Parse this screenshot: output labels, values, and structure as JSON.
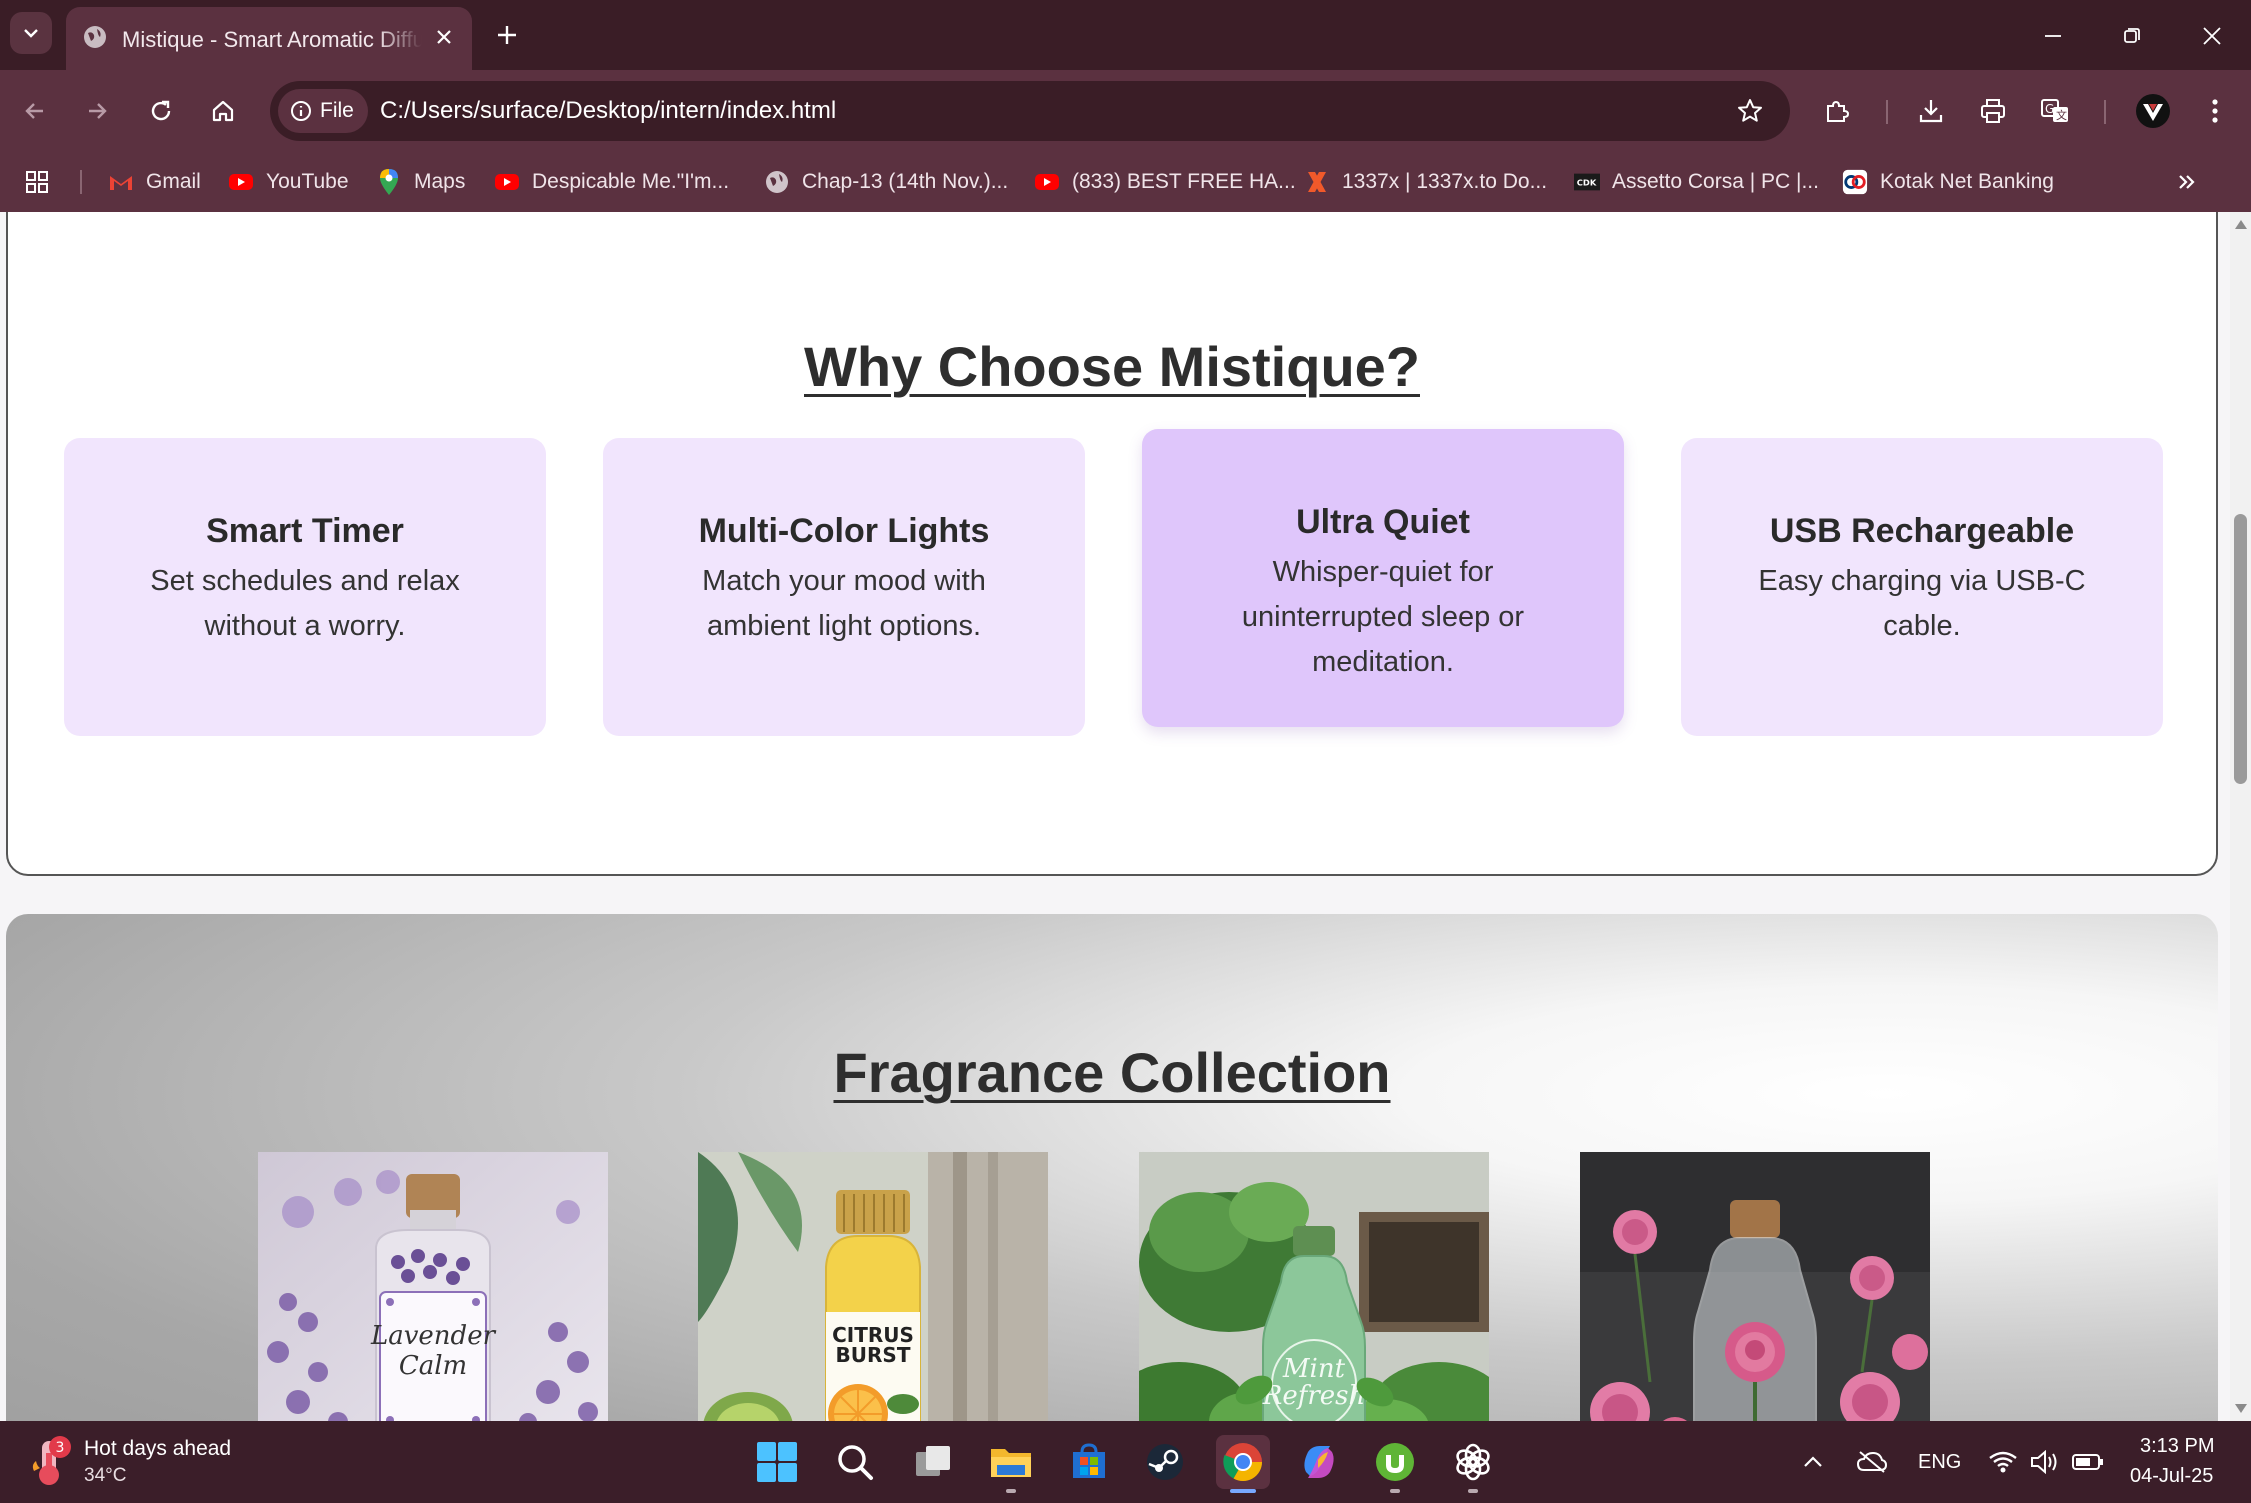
{
  "browser": {
    "tab_title": "Mistique - Smart Aromatic Diffuser",
    "address_chip": "File",
    "url": "C:/Users/surface/Desktop/intern/index.html",
    "bookmarks": [
      {
        "label": "Gmail",
        "icon": "gmail-icon"
      },
      {
        "label": "YouTube",
        "icon": "youtube-icon"
      },
      {
        "label": "Maps",
        "icon": "maps-icon"
      },
      {
        "label": "Despicable Me.\"I'm...",
        "icon": "youtube-icon"
      },
      {
        "label": "Chap-13 (14th Nov.)...",
        "icon": "globe-icon"
      },
      {
        "label": "(833) BEST FREE HA...",
        "icon": "youtube-icon"
      },
      {
        "label": "1337x | 1337x.to Do...",
        "icon": "x-icon"
      },
      {
        "label": "Assetto Corsa | PC |...",
        "icon": "cdk-icon"
      },
      {
        "label": "Kotak Net Banking",
        "icon": "kotak-icon"
      }
    ]
  },
  "why": {
    "title": "Why Choose Mistique?",
    "features": [
      {
        "title": "Smart Timer",
        "text": "Set schedules and relax without a worry."
      },
      {
        "title": "Multi-Color Lights",
        "text": "Match your mood with ambient light options."
      },
      {
        "title": "Ultra Quiet",
        "text": "Whisper-quiet for uninterrupted sleep or meditation."
      },
      {
        "title": "USB Rechargeable",
        "text": "Easy charging via USB-C cable."
      }
    ]
  },
  "fragrance": {
    "title": "Fragrance Collection",
    "products": [
      {
        "label_line1": "Lavender",
        "label_line2": "Calm"
      },
      {
        "label_line1": "CITRUS",
        "label_line2": "BURST"
      },
      {
        "label_line1": "Mint",
        "label_line2": "Refresh"
      },
      {
        "label_line1": "",
        "label_line2": ""
      }
    ]
  },
  "taskbar": {
    "weather_badge": "3",
    "weather_title": "Hot days ahead",
    "weather_temp": "34°C",
    "language": "ENG",
    "time": "3:13 PM",
    "date": "04-Jul-25"
  },
  "colors": {
    "chrome_dark": "#3a1d26",
    "chrome_mid": "#5b3140",
    "card": "#f1e5fd",
    "card_active": "#dfc6fb"
  }
}
